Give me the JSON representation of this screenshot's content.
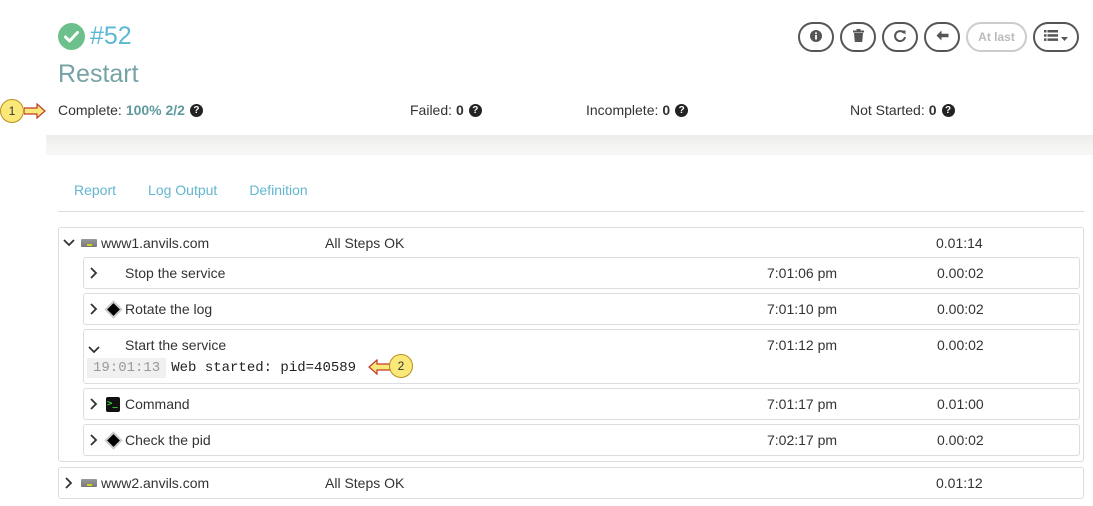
{
  "header": {
    "execution_id": "#52",
    "job_name": "Restart",
    "status_icon": "check-circle-icon",
    "status_color": "#6cc08b"
  },
  "toolbar": {
    "buttons": [
      {
        "name": "info",
        "icon": "info-icon"
      },
      {
        "name": "delete",
        "icon": "trash-icon"
      },
      {
        "name": "rerun",
        "icon": "refresh-icon"
      },
      {
        "name": "back",
        "icon": "arrow-left-icon"
      },
      {
        "name": "at-last",
        "label": "At last",
        "disabled": true
      },
      {
        "name": "view-menu",
        "icon": "list-dropdown-icon"
      }
    ],
    "at_last_label": "At last"
  },
  "callouts": {
    "one": "1",
    "two": "2"
  },
  "stats": {
    "complete_label": "Complete:",
    "complete_value": "100% 2/2",
    "failed_label": "Failed:",
    "failed_value": "0",
    "incomplete_label": "Incomplete:",
    "incomplete_value": "0",
    "not_started_label": "Not Started:",
    "not_started_value": "0",
    "help_glyph": "?"
  },
  "tabs": [
    {
      "label": "Report"
    },
    {
      "label": "Log Output"
    },
    {
      "label": "Definition"
    }
  ],
  "nodes": [
    {
      "name": "www1.anvils.com",
      "status": "All Steps OK",
      "duration": "0.01:14",
      "expanded": true,
      "steps": [
        {
          "name": "Stop the service",
          "time": "7:01:06 pm",
          "duration": "0.00:02",
          "icon": "none"
        },
        {
          "name": "Rotate the log",
          "time": "7:01:10 pm",
          "duration": "0.00:02",
          "icon": "diamond-icon"
        },
        {
          "name": "Start the service",
          "time": "7:01:12 pm",
          "duration": "0.00:02",
          "icon": "none",
          "expanded": true,
          "log": {
            "timestamp": "19:01:13",
            "message": "Web started: pid=40589"
          }
        },
        {
          "name": "Command",
          "time": "7:01:17 pm",
          "duration": "0.01:00",
          "icon": "terminal-icon"
        },
        {
          "name": "Check the pid",
          "time": "7:02:17 pm",
          "duration": "0.00:02",
          "icon": "diamond-icon"
        }
      ]
    },
    {
      "name": "www2.anvils.com",
      "status": "All Steps OK",
      "duration": "0.01:12",
      "expanded": false
    }
  ],
  "glyphs": {
    "chev_down": "⌄",
    "chev_right": "›",
    "terminal": ">_"
  }
}
